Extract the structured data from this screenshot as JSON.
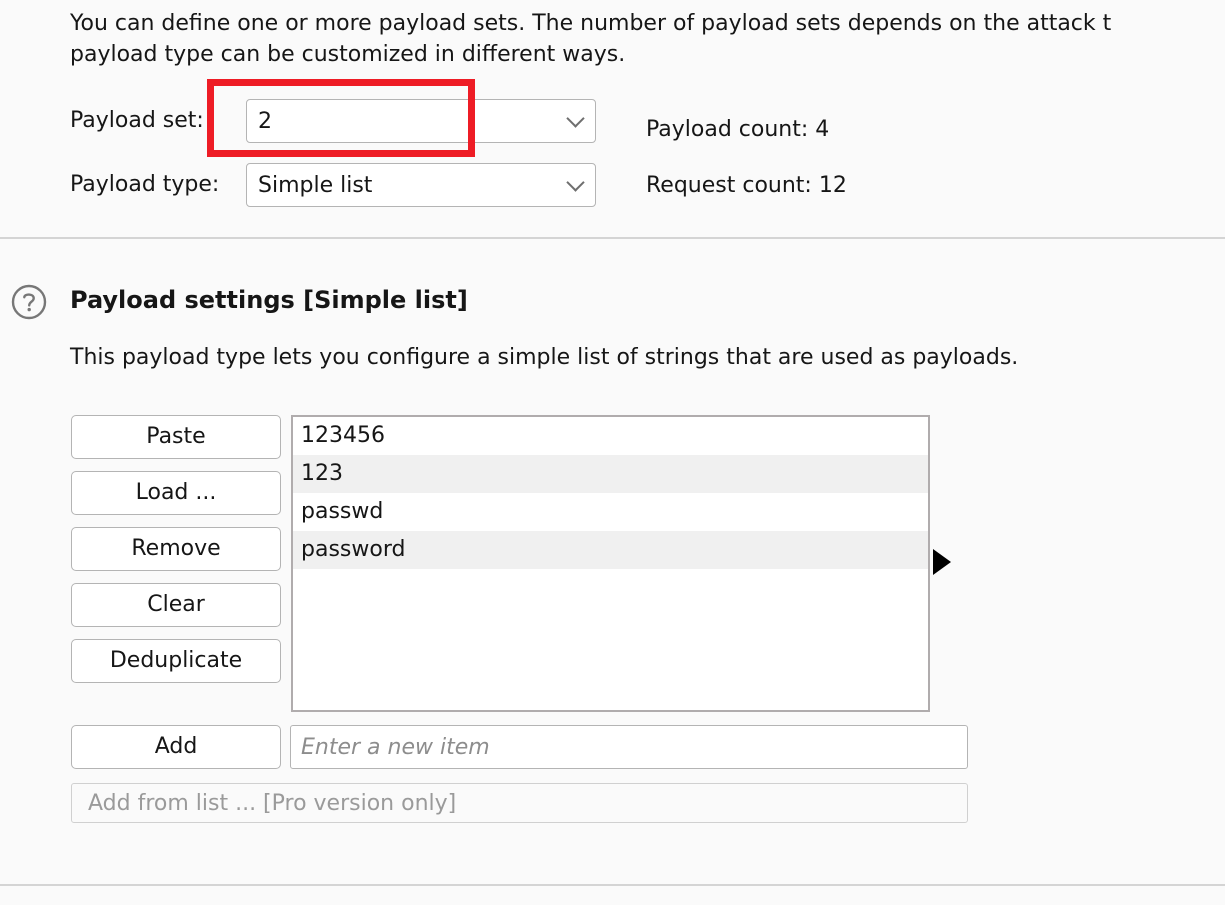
{
  "intro": {
    "line1": "You can define one or more payload sets. The number of payload sets depends on the attack t",
    "line2": "payload type can be customized in different ways."
  },
  "payload_set": {
    "label": "Payload set:",
    "value": "2",
    "chevron_icon": "chevron-down-icon"
  },
  "payload_type": {
    "label": "Payload type:",
    "value": "Simple list",
    "chevron_icon": "chevron-down-icon"
  },
  "counts": {
    "payload_count": "Payload count:  4",
    "request_count": "Request count: 12"
  },
  "annotation": {
    "color": "#ee1c25",
    "target": "payload-set-combo"
  },
  "section": {
    "help_icon": "question-circle-icon",
    "title": "Payload settings [Simple list]",
    "description": "This payload type lets you configure a simple list of strings that are used as payloads."
  },
  "buttons": [
    {
      "label": "Paste"
    },
    {
      "label": "Load ..."
    },
    {
      "label": "Remove"
    },
    {
      "label": "Clear"
    },
    {
      "label": "Deduplicate"
    }
  ],
  "payload_list": {
    "items": [
      "123456",
      "123",
      "passwd",
      "password"
    ]
  },
  "add_row": {
    "button_label": "Add",
    "input_value": "",
    "input_placeholder": "Enter a new item"
  },
  "pro_dropdown": {
    "label": "Add from list ... [Pro version only]",
    "chevron_icon": "chevron-down-icon",
    "disabled": true
  },
  "cursor": {
    "icon": "mouse-pointer-right-arrow"
  }
}
